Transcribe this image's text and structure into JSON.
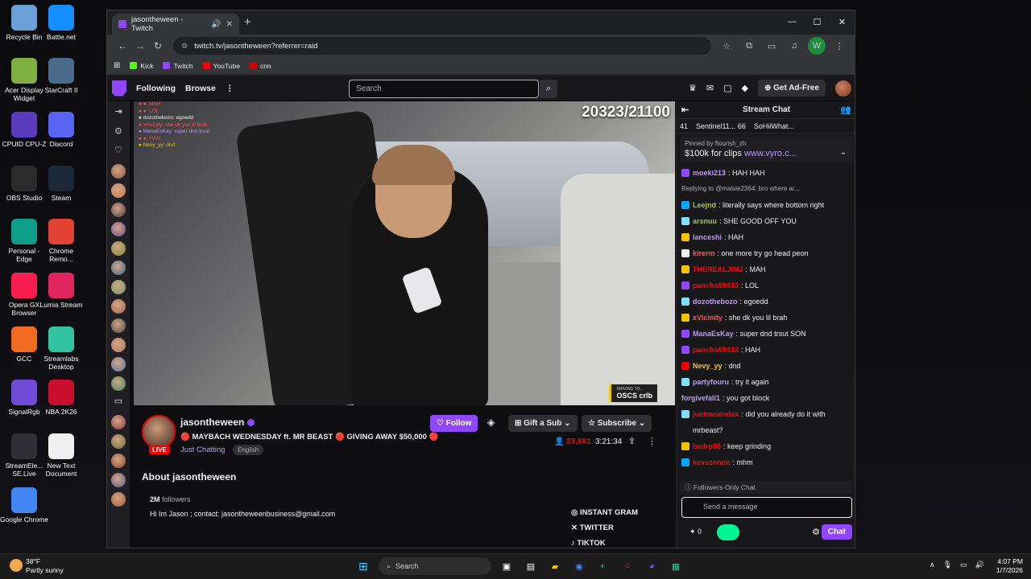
{
  "desktop": {
    "icons": [
      {
        "label": "Recycle Bin",
        "icon": "recycle-bin-icon",
        "color": "#6aa0d8"
      },
      {
        "label": "Battle.net",
        "icon": "battlenet-icon",
        "color": "#148eff"
      },
      {
        "label": "Acer Display Widget",
        "icon": "acer-icon",
        "color": "#80b040"
      },
      {
        "label": "StarCraft II",
        "icon": "starcraft-icon",
        "color": "#4a6a8a"
      },
      {
        "label": "CPUID CPU-Z",
        "icon": "cpuz-icon",
        "color": "#5a3bbd"
      },
      {
        "label": "Discord",
        "icon": "discord-icon",
        "color": "#5865f2"
      },
      {
        "label": "OBS Studio",
        "icon": "obs-icon",
        "color": "#2b2b2b"
      },
      {
        "label": "Steam",
        "icon": "steam-icon",
        "color": "#1b2838"
      },
      {
        "label": "Personal - Edge",
        "icon": "edge-icon",
        "color": "#0f9e8a"
      },
      {
        "label": "Chrome Remo...",
        "icon": "chrome-remote-icon",
        "color": "#e34133"
      },
      {
        "label": "Opera GX Browser",
        "icon": "opera-gx-icon",
        "color": "#fa1e4e"
      },
      {
        "label": "Lumia Stream",
        "icon": "lumia-icon",
        "color": "#e0245e"
      },
      {
        "label": "GCC",
        "icon": "gcc-icon",
        "color": "#f26b21"
      },
      {
        "label": "Streamlabs Desktop",
        "icon": "streamlabs-icon",
        "color": "#31c3a2"
      },
      {
        "label": "SignalRgb",
        "icon": "signalrgb-icon",
        "color": "#6f4bd8"
      },
      {
        "label": "NBA 2K26",
        "icon": "nba-icon",
        "color": "#c8102e"
      },
      {
        "label": "StreamEle... SE.Live",
        "icon": "streamelements-icon",
        "color": "#2f2f35"
      },
      {
        "label": "New Text Document",
        "icon": "text-document-icon",
        "color": "#f0f0f0"
      },
      {
        "label": "Google Chrome",
        "icon": "chrome-icon",
        "color": "#4285f4"
      }
    ]
  },
  "browser": {
    "tab_title": "jasontheween - Twitch",
    "url": "twitch.tv/jasontheween?referrer=raid",
    "bookmarks": [
      {
        "label": "Kick",
        "color": "#53fc18"
      },
      {
        "label": "Twitch",
        "color": "#9146ff"
      },
      {
        "label": "YouTube",
        "color": "#ff0000"
      },
      {
        "label": "cnn",
        "color": "#cc0000"
      }
    ],
    "profile_letter": "W"
  },
  "twitch": {
    "nav": {
      "following": "Following",
      "browse": "Browse"
    },
    "search_placeholder": "Search",
    "get_ad_free": "Get Ad-Free",
    "video": {
      "counter": "20323/21100",
      "driving_small": "DRIVING TO...",
      "driving_big": "OSCS crlb",
      "overlay_chat": [
        "● ●: MAH",
        "● ●: LOL",
        "● dozothebozo: egoedd",
        "● xVicinity: she dk you lil brah",
        "● ManaEsKay: super dnd trsut",
        "● ●: HAH",
        "● Nevy_yy: dnd"
      ]
    },
    "channel": {
      "name": "jasontheween",
      "title": "🔴 MAYBACH WEDNESDAY ft. MR BEAST 🔴 GIVING AWAY $50,000 🔴",
      "category": "Just Chatting",
      "tag": "English",
      "live": "LIVE",
      "follow": "Follow",
      "gift_sub": "Gift a Sub",
      "subscribe": "Subscribe",
      "viewers": "23,881",
      "uptime": "3:21:34",
      "about_heading": "About jasontheween",
      "followers_count": "2M",
      "followers_label": "followers",
      "bio": "Hi Im Jason ; contact: jasontheweenbusiness@gmail.com",
      "socials": [
        "INSTANT GRAM",
        "TWITTER",
        "TIKTOK"
      ]
    },
    "chat": {
      "header": "Stream Chat",
      "gifters": [
        {
          "text": "41"
        },
        {
          "text": "Sentinel11... 66"
        },
        {
          "text": "SoHiiWhat..."
        }
      ],
      "pinned_by": "Pinned by flourish_zh",
      "pinned_text": "$100k for clips ",
      "pinned_link": "www.vyro.c...",
      "reply_text": "Replying to @maisie2364: bro where ar...",
      "messages": [
        {
          "user": "moeki213",
          "text": "HAH HAH",
          "color": "#bf94ff",
          "badge": "#9146ff"
        },
        {
          "user": "Leejnd",
          "text": "literally says where bottom right",
          "color": "#9acd32",
          "badge": "#00a8ff",
          "reply": true
        },
        {
          "user": "arsnuu",
          "text": "SHE GOOD OFF YOU",
          "color": "#9acd32",
          "badge": "#7fe1ff"
        },
        {
          "user": "lanceshi",
          "text": "HAH",
          "color": "#bf94ff",
          "badge": "#f5c400"
        },
        {
          "user": "kirerm",
          "text": "one more try go head peon",
          "color": "#ff4f4f",
          "badge": "#efeff1"
        },
        {
          "user": "THEREALJIMJ",
          "text": "MAH",
          "color": "#ff0000",
          "badge": "#f5c400"
        },
        {
          "user": "pancho98433",
          "text": "LOL",
          "color": "#ff0000",
          "badge": "#9146ff"
        },
        {
          "user": "dozothebozo",
          "text": "egoedd",
          "color": "#bf94ff",
          "badge": "#7fe1ff"
        },
        {
          "user": "xVicinity",
          "text": "she dk you lil brah",
          "color": "#ff4f4f",
          "badge": "#f5c400"
        },
        {
          "user": "ManaEsKay",
          "text": "super dnd trsut SON",
          "color": "#bf94ff",
          "badge": "#9146ff"
        },
        {
          "user": "pancho98433",
          "text": "HAH",
          "color": "#ff0000",
          "badge": "#9146ff"
        },
        {
          "user": "Nevy_yy",
          "text": "dnd",
          "color": "#f5c400",
          "badge": "#eb0400"
        },
        {
          "user": "partyfouru",
          "text": "try it again",
          "color": "#bf94ff",
          "badge": "#7fe1ff"
        },
        {
          "user": "forgivefall1",
          "text": "you got block",
          "color": "#bf94ff",
          "badge": ""
        },
        {
          "user": "justmewndox",
          "text": "did you already do it with mrbeast?",
          "color": "#ff0000",
          "badge": "#7fe1ff"
        },
        {
          "user": "badrp05",
          "text": "keep grinding",
          "color": "#ff0000",
          "badge": "#f5c400"
        },
        {
          "user": "kevsznnnn",
          "text": "mhm",
          "color": "#ff0000",
          "badge": "#00a8ff"
        }
      ],
      "followers_only": "Followers-Only Chat",
      "input_placeholder": "Send a message",
      "points": "0",
      "chat_button": "Chat"
    }
  },
  "taskbar": {
    "temp": "38°F",
    "weather": "Partly sunny",
    "search": "Search",
    "time": "4:07 PM",
    "date": "1/7/2026"
  }
}
